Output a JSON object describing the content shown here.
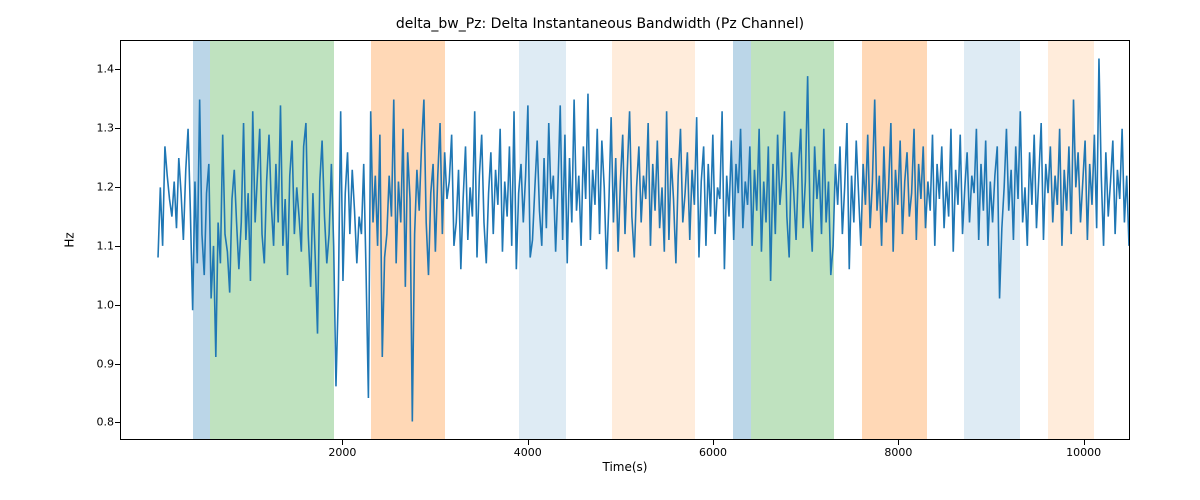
{
  "chart_data": {
    "type": "line",
    "title": "delta_bw_Pz: Delta Instantaneous Bandwidth (Pz Channel)",
    "xlabel": "Time(s)",
    "ylabel": "Hz",
    "xlim": [
      -400,
      10500
    ],
    "ylim": [
      0.77,
      1.45
    ],
    "xticks": [
      2000,
      4000,
      6000,
      8000,
      10000
    ],
    "yticks": [
      0.8,
      0.9,
      1.0,
      1.1,
      1.2,
      1.3,
      1.4
    ],
    "line_color": "#1f77b4",
    "spans": [
      {
        "x0": 380,
        "x1": 560,
        "color": "#1f77b4",
        "alpha": 0.3
      },
      {
        "x0": 560,
        "x1": 1900,
        "color": "#2ca02c",
        "alpha": 0.3
      },
      {
        "x0": 2300,
        "x1": 3100,
        "color": "#ff7f0e",
        "alpha": 0.3
      },
      {
        "x0": 3900,
        "x1": 4400,
        "color": "#1f77b4",
        "alpha": 0.15
      },
      {
        "x0": 4900,
        "x1": 5800,
        "color": "#ff7f0e",
        "alpha": 0.15
      },
      {
        "x0": 6200,
        "x1": 6400,
        "color": "#1f77b4",
        "alpha": 0.3
      },
      {
        "x0": 6400,
        "x1": 7300,
        "color": "#2ca02c",
        "alpha": 0.3
      },
      {
        "x0": 7600,
        "x1": 8300,
        "color": "#ff7f0e",
        "alpha": 0.3
      },
      {
        "x0": 8700,
        "x1": 9300,
        "color": "#1f77b4",
        "alpha": 0.15
      },
      {
        "x0": 9600,
        "x1": 10100,
        "color": "#ff7f0e",
        "alpha": 0.15
      }
    ],
    "series": [
      {
        "name": "delta_bw_Pz",
        "x_start": 0,
        "x_step": 25,
        "values": [
          1.08,
          1.2,
          1.1,
          1.27,
          1.22,
          1.18,
          1.15,
          1.21,
          1.13,
          1.25,
          1.19,
          1.11,
          1.23,
          1.3,
          1.16,
          0.99,
          1.21,
          1.07,
          1.35,
          1.12,
          1.05,
          1.19,
          1.24,
          1.01,
          1.1,
          0.91,
          1.14,
          1.07,
          1.29,
          1.12,
          1.09,
          1.02,
          1.18,
          1.23,
          1.14,
          1.06,
          1.14,
          1.31,
          1.11,
          1.19,
          1.04,
          1.33,
          1.14,
          1.22,
          1.3,
          1.12,
          1.07,
          1.21,
          1.29,
          1.17,
          1.1,
          1.24,
          1.14,
          1.34,
          1.1,
          1.18,
          1.05,
          1.22,
          1.28,
          1.12,
          1.2,
          1.15,
          1.09,
          1.27,
          1.31,
          1.12,
          1.03,
          1.19,
          1.08,
          0.95,
          1.21,
          1.28,
          1.15,
          1.07,
          1.12,
          1.24,
          1.1,
          0.86,
          1.02,
          1.33,
          1.04,
          1.19,
          1.26,
          1.12,
          1.23,
          1.16,
          1.07,
          1.15,
          1.12,
          1.24,
          1.05,
          0.84,
          1.33,
          1.14,
          1.22,
          1.1,
          1.29,
          0.91,
          1.08,
          1.12,
          1.22,
          1.15,
          1.35,
          1.07,
          1.21,
          1.14,
          1.3,
          1.03,
          1.26,
          1.18,
          0.8,
          1.12,
          1.23,
          1.16,
          1.27,
          1.35,
          1.14,
          1.05,
          1.19,
          1.24,
          1.09,
          1.22,
          1.31,
          1.12,
          1.26,
          1.18,
          1.21,
          1.29,
          1.1,
          1.14,
          1.23,
          1.06,
          1.18,
          1.27,
          1.11,
          1.2,
          1.15,
          1.33,
          1.08,
          1.22,
          1.29,
          1.14,
          1.07,
          1.19,
          1.26,
          1.12,
          1.23,
          1.17,
          1.3,
          1.09,
          1.21,
          1.15,
          1.27,
          1.1,
          1.33,
          1.06,
          1.19,
          1.24,
          1.14,
          1.22,
          1.34,
          1.08,
          1.11,
          1.2,
          1.28,
          1.16,
          1.1,
          1.25,
          1.13,
          1.31,
          1.18,
          1.22,
          1.09,
          1.2,
          1.34,
          1.11,
          1.29,
          1.07,
          1.25,
          1.14,
          1.35,
          1.16,
          1.22,
          1.1,
          1.27,
          1.18,
          1.36,
          1.11,
          1.23,
          1.17,
          1.3,
          1.12,
          1.28,
          1.2,
          1.06,
          1.17,
          1.32,
          1.14,
          1.25,
          1.09,
          1.21,
          1.29,
          1.12,
          1.23,
          1.33,
          1.15,
          1.08,
          1.2,
          1.27,
          1.14,
          1.22,
          1.18,
          1.31,
          1.1,
          1.24,
          1.16,
          1.28,
          1.13,
          1.2,
          1.09,
          1.33,
          1.11,
          1.25,
          1.18,
          1.07,
          1.22,
          1.3,
          1.14,
          1.19,
          1.26,
          1.11,
          1.23,
          1.17,
          1.32,
          1.08,
          1.21,
          1.27,
          1.1,
          1.24,
          1.15,
          1.29,
          1.12,
          1.2,
          1.18,
          1.33,
          1.06,
          1.22,
          1.15,
          1.28,
          1.11,
          1.24,
          1.19,
          1.3,
          1.13,
          1.21,
          1.17,
          1.27,
          1.1,
          1.23,
          1.16,
          1.3,
          1.09,
          1.21,
          1.14,
          1.27,
          1.04,
          1.24,
          1.12,
          1.29,
          1.17,
          1.22,
          1.33,
          1.15,
          1.08,
          1.26,
          1.19,
          1.11,
          1.23,
          1.3,
          1.13,
          1.21,
          1.39,
          1.16,
          1.09,
          1.27,
          1.18,
          1.23,
          1.12,
          1.3,
          1.14,
          1.21,
          1.05,
          1.1,
          1.24,
          1.17,
          1.27,
          1.12,
          1.2,
          1.31,
          1.06,
          1.22,
          1.14,
          1.28,
          1.19,
          1.1,
          1.24,
          1.17,
          1.29,
          1.13,
          1.21,
          1.35,
          1.16,
          1.22,
          1.1,
          1.27,
          1.14,
          1.2,
          1.31,
          1.09,
          1.23,
          1.17,
          1.28,
          1.12,
          1.21,
          1.26,
          1.15,
          1.19,
          1.3,
          1.11,
          1.24,
          1.18,
          1.27,
          1.13,
          1.21,
          1.16,
          1.29,
          1.1,
          1.24,
          1.18,
          1.27,
          1.13,
          1.21,
          1.15,
          1.3,
          1.09,
          1.23,
          1.17,
          1.29,
          1.12,
          1.2,
          1.26,
          1.14,
          1.22,
          1.19,
          1.3,
          1.11,
          1.24,
          1.16,
          1.28,
          1.1,
          1.21,
          1.14,
          1.22,
          1.27,
          1.01,
          1.13,
          1.2,
          1.3,
          1.16,
          1.23,
          1.11,
          1.27,
          1.18,
          1.33,
          1.14,
          1.2,
          1.1,
          1.26,
          1.17,
          1.29,
          1.13,
          1.22,
          1.31,
          1.11,
          1.24,
          1.19,
          1.27,
          1.14,
          1.22,
          1.17,
          1.3,
          1.1,
          1.23,
          1.16,
          1.27,
          1.12,
          1.35,
          1.2,
          1.26,
          1.14,
          1.21,
          1.28,
          1.11,
          1.24,
          1.17,
          1.29,
          1.13,
          1.42,
          1.22,
          1.1,
          1.26,
          1.15,
          1.21,
          1.28,
          1.12,
          1.23,
          1.18,
          1.3,
          1.14,
          1.22,
          1.1,
          1.19,
          1.17,
          1.19
        ]
      }
    ]
  }
}
